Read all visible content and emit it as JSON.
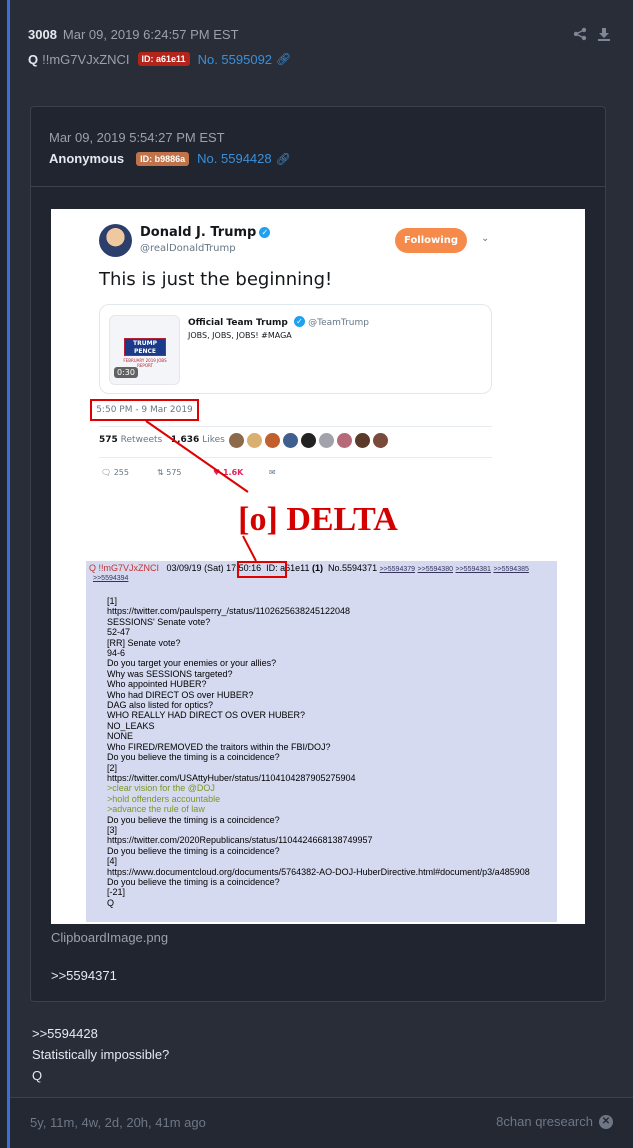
{
  "post": {
    "number": "3008",
    "date": "Mar 09, 2019 6:24:57 PM EST",
    "author": "Q",
    "tripcode": "!!mG7VJxZNCI",
    "id_badge": "ID: a61e11",
    "id_color": "#b3241b",
    "post_no": "No. 5595092",
    "body_lines": [
      ">>5594428",
      "Statistically impossible?",
      "Q"
    ],
    "age": "5y, 11m, 4w, 2d, 20h, 41m ago",
    "source": "8chan qresearch"
  },
  "quoted": {
    "date": "Mar 09, 2019 5:54:27 PM EST",
    "author": "Anonymous",
    "id_badge": "ID: b9886a",
    "id_color": "#c0734a",
    "post_no": "No. 5594428",
    "image_name": "ClipboardImage.png",
    "reference": ">>5594371"
  },
  "tweet": {
    "name": "Donald J. Trump",
    "handle": "@realDonaldTrump",
    "follow_label": "Following",
    "text": "This is just the beginning!",
    "embed_name": "Official Team Trump",
    "embed_handle": "@TeamTrump",
    "embed_text": "JOBS, JOBS, JOBS! #MAGA",
    "thumb_logo": "TRUMP PENCE",
    "thumb_sub": "FEBRUARY 2019 JOBS REPORT",
    "thumb_time": "0:30",
    "timestamp": "5:50 PM - 9 Mar 2019",
    "retweets_n": "575",
    "retweets_l": "Retweets",
    "likes_n": "1,636",
    "likes_l": "Likes",
    "replies_count": "255",
    "rt_count": "575",
    "like_count": "1.6K"
  },
  "delta_label": "[o] DELTA",
  "qdrop": {
    "header_name": "Q !!mG7VJxZNCI",
    "header_date": "03/09/19 (Sat) 17:50:16",
    "header_id": "ID: a61e11",
    "header_count": "(1)",
    "header_no": "No.5594371",
    "links": [
      ">>5594379",
      ">>5594380",
      ">>5594381",
      ">>5594385"
    ],
    "sublink": ">>5594394",
    "lines": [
      "[1]",
      "https://twitter.com/paulsperry_/status/1102625638245122048",
      "SESSIONS' Senate vote?",
      "52-47",
      "[RR] Senate vote?",
      "94-6",
      "Do you target your enemies or your allies?",
      "Why was SESSIONS targeted?",
      "Who appointed HUBER?",
      "Who had DIRECT OS over HUBER?",
      "DAG also listed for optics?",
      "WHO REALLY HAD DIRECT OS OVER HUBER?",
      "NO_LEAKS",
      "NONE",
      "Who FIRED/REMOVED the traitors within the FBI/DOJ?",
      "Do you believe the timing is a coincidence?",
      "[2]",
      "https://twitter.com/USAttyHuber/status/1104104287905275904",
      ">clear vision for the @DOJ",
      ">hold offenders accountable",
      ">advance the rule of law",
      "Do you believe the timing is a coincidence?",
      "[3]",
      "https://twitter.com/2020Republicans/status/1104424668138749957",
      "Do you believe the timing is a coincidence?",
      "[4]",
      "https://www.documentcloud.org/documents/5764382-AO-DOJ-HuberDirective.html#document/p3/a485908",
      "Do you believe the timing is a coincidence?",
      "[-21]",
      "Q"
    ]
  }
}
